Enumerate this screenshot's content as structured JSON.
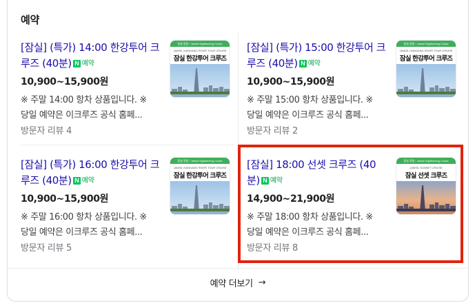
{
  "section": {
    "title": "예약"
  },
  "badge": {
    "n": "N",
    "label": "예약"
  },
  "cards": [
    {
      "title": "[잠실] (특가) 14:00 한강투어 크루즈 (40분)",
      "price": "10,900~15,900원",
      "desc_line1": "※ 주말 14:00 항차 상품입니다. ※",
      "desc_line2": "당일 예약은 이크루즈 공식 홈페...",
      "reviews": "방문자 리뷰 4",
      "thumb": {
        "bar": "잠실 정원 / Jamsil Sightseeing Cruise",
        "sub": "JAMSIL HANGANG RIVER TOUR CRUISE",
        "head": "잠실 한강투어 크루즈",
        "scene": "day"
      }
    },
    {
      "title": "[잠실] (특가) 15:00 한강투어 크루즈 (40분)",
      "price": "10,900~15,900원",
      "desc_line1": "※ 주말 15:00 항차 상품입니다. ※",
      "desc_line2": "당일 예약은 이크루즈 공식 홈페...",
      "reviews": "방문자 리뷰 2",
      "thumb": {
        "bar": "잠실 정원 / Jamsil Sightseeing Cruise",
        "sub": "JAMSIL HANGANG RIVER TOUR CRUISE",
        "head": "잠실 한강투어 크루즈",
        "scene": "day"
      }
    },
    {
      "title": "[잠실] (특가) 16:00 한강투어 크루즈 (40분)",
      "price": "10,900~15,900원",
      "desc_line1": "※ 주말 16:00 항차 상품입니다. ※",
      "desc_line2": "당일 예약은 이크루즈 공식 홈페...",
      "reviews": "방문자 리뷰 5",
      "thumb": {
        "bar": "잠실 정원 / Jamsil Sightseeing Cruise",
        "sub": "JAMSIL HANGANG RIVER TOUR CRUISE",
        "head": "잠실 한강투어 크루즈",
        "scene": "day"
      }
    },
    {
      "title": "[잠실] 18:00 선셋 크루즈 (40분)",
      "price": "14,900~21,900원",
      "desc_line1": "※ 주말 18:00 항차 상품입니다. ※",
      "desc_line2": "당일 예약은 이크루즈 공식 홈페...",
      "reviews": "방문자 리뷰 8",
      "thumb": {
        "bar": "잠실 정원 / Jamsil Sightseeing Cruise",
        "sub": "JAMSIL SUNSET CRUISE",
        "head": "잠실 선셋 크루즈",
        "scene": "sunset"
      }
    }
  ],
  "more": {
    "label": "예약 더보기",
    "arrow": "→"
  },
  "colors": {
    "link": "#1a0dab",
    "naver_green": "#03c75a",
    "highlight": "#e0230d"
  }
}
